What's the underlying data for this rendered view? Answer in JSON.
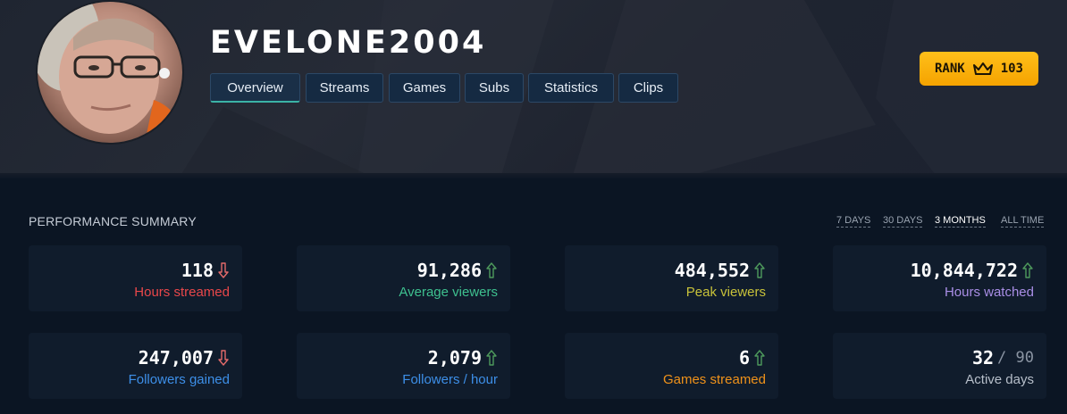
{
  "profile": {
    "username": "EVELONE2004"
  },
  "tabs": [
    {
      "label": "Overview",
      "active": true
    },
    {
      "label": "Streams",
      "active": false
    },
    {
      "label": "Games",
      "active": false
    },
    {
      "label": "Subs",
      "active": false
    },
    {
      "label": "Statistics",
      "active": false
    },
    {
      "label": "Clips",
      "active": false
    }
  ],
  "rank": {
    "label": "RANK",
    "value": "103",
    "icon": "crown-icon",
    "color": "#ffb400"
  },
  "performance": {
    "title": "PERFORMANCE SUMMARY",
    "ranges": [
      {
        "label": "7 DAYS",
        "active": false
      },
      {
        "label": "30 DAYS",
        "active": false
      },
      {
        "label": "3 MONTHS",
        "active": true
      },
      {
        "label": "ALL TIME",
        "active": false
      }
    ],
    "stats": [
      {
        "value": "118",
        "label": "Hours streamed",
        "trend": "down",
        "label_color": "#e8474a"
      },
      {
        "value": "91,286",
        "label": "Average viewers",
        "trend": "up",
        "label_color": "#3ec08f"
      },
      {
        "value": "484,552",
        "label": "Peak viewers",
        "trend": "up",
        "label_color": "#c8c23a"
      },
      {
        "value": "10,844,722",
        "label": "Hours watched",
        "trend": "up",
        "label_color": "#a98ee6"
      },
      {
        "value": "247,007",
        "label": "Followers gained",
        "trend": "down",
        "label_color": "#3d8fe8"
      },
      {
        "value": "2,079",
        "label": "Followers / hour",
        "trend": "up",
        "label_color": "#3d8fe8"
      },
      {
        "value": "6",
        "label": "Games streamed",
        "trend": "up",
        "label_color": "#f0921a"
      },
      {
        "value": "32",
        "suffix": "/ 90",
        "label": "Active days",
        "trend": "none",
        "label_color": "#b7bfca"
      }
    ],
    "trend_colors": {
      "up": "#4e9a5c",
      "down": "#e36a6a"
    }
  }
}
